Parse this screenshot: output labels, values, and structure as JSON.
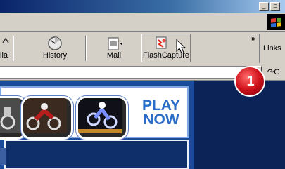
{
  "toolbar": {
    "media_label_partial": "lia",
    "history_label": "History",
    "mail_label": "Mail",
    "flashcapture_label": "FlashCapture",
    "links_label": "Links",
    "chevron_label": "»"
  },
  "window": {
    "minimize_label": "_",
    "maximize_label": "▫"
  },
  "address": {
    "value": "",
    "go_label_partial": "G"
  },
  "page": {
    "play_now_line1": "PLAY",
    "play_now_line2": "NOW",
    "badge_number": "1"
  },
  "colors": {
    "titlebar": "#0a246a",
    "page_bg": "#0d2a63",
    "play_now": "#2a6dc8",
    "badge_red": "#d0121b"
  }
}
